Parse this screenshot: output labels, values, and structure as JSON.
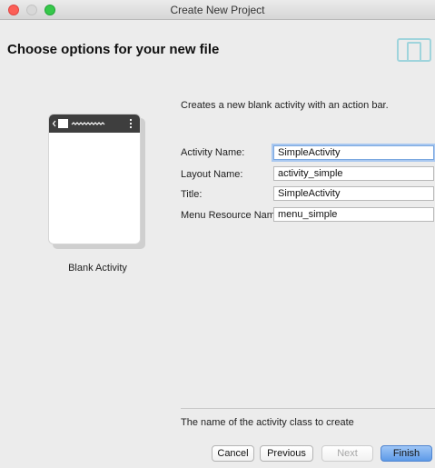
{
  "window": {
    "title": "Create New Project"
  },
  "header": {
    "title": "Choose options for your new file",
    "icon": "device-frame-icon"
  },
  "template": {
    "name": "Blank Activity",
    "description": "Creates a new blank activity with an action bar."
  },
  "form": {
    "fields": [
      {
        "label": "Activity Name:",
        "value": "SimpleActivity"
      },
      {
        "label": "Layout Name:",
        "value": "activity_simple"
      },
      {
        "label": "Title:",
        "value": "SimpleActivity"
      },
      {
        "label": "Menu Resource Name:",
        "value": "menu_simple"
      }
    ]
  },
  "help_text": "The name of the activity class to create",
  "buttons": {
    "cancel": "Cancel",
    "previous": "Previous",
    "next": "Next",
    "finish": "Finish"
  },
  "colors": {
    "accent": "#5d9ae8",
    "close": "#fc5f57",
    "maximize": "#36c84a"
  }
}
